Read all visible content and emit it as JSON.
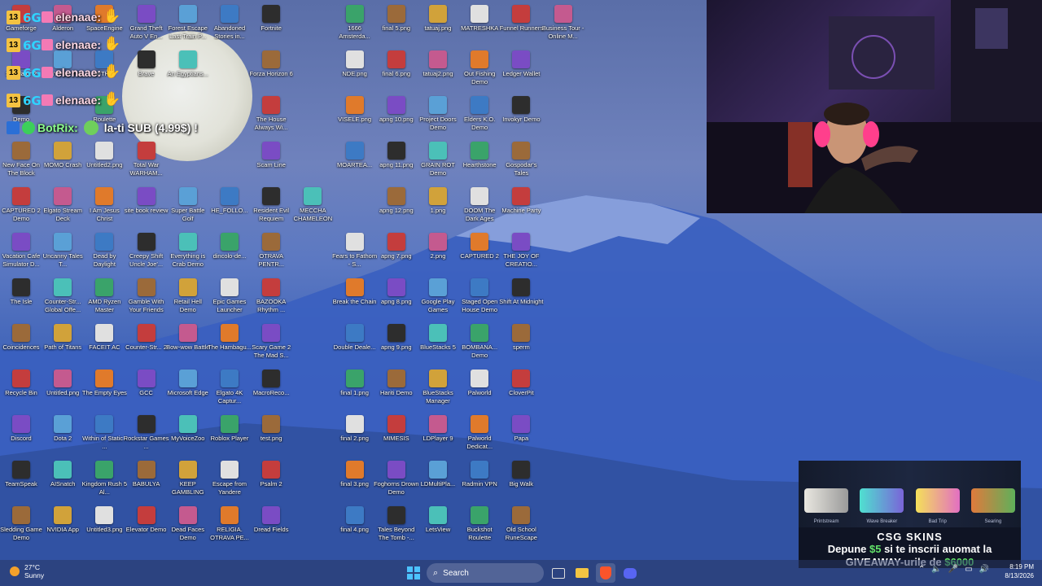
{
  "chat": {
    "messages": [
      {
        "badge": "13",
        "user": "elenaae:",
        "emote": "hands-clap"
      },
      {
        "badge": "13",
        "user": "elenaae:",
        "emote": "hands-clap"
      },
      {
        "badge": "13",
        "user": "elenaae:",
        "emote": "hands-clap"
      },
      {
        "badge": "13",
        "user": "elenaae:",
        "emote": "hands-clap"
      }
    ],
    "bot": {
      "name": "BotRix:",
      "message": "la-ti SUB (4.99$) !"
    }
  },
  "desktop": {
    "columns": [
      [
        "Gameforge",
        "Simulator ?",
        "Demo",
        "New Face On The Block",
        "CAPTURED 2 Demo",
        "Vacation Cafe Simulator D...",
        "The Isle",
        "Coincidences",
        "Recycle Bin",
        "Discord",
        "TeamSpeak",
        "Sledding Game Demo"
      ],
      [
        "Alderon",
        "Don't Play This",
        "",
        "MOMO Crash",
        "Elgato Stream Deck",
        "Uncanny Tales T...",
        "Counter-Str... Global Offe...",
        "Path of Titans",
        "Untitled.png",
        "Dota 2",
        "AISnatch",
        "NVIDIA App"
      ],
      [
        "SpaceEngine",
        "MITHAI",
        "Roulette",
        "Untitled2.png",
        "I Am Jesus Christ",
        "Dead by Daylight",
        "AMD Ryzen Master",
        "FACEIT AC",
        "The Empty Eyes",
        "Within of Static - ...",
        "Kingdom Rush 5 Al...",
        "Untitled3.png"
      ],
      [
        "Grand Theft Auto V En...",
        "Brave",
        "",
        "Total War WARHAM...",
        "site book review",
        "Creepy Shift Uncle Joe'...",
        "Gamble With Your Friends",
        "Counter-Str... 2",
        "GCC",
        "Rockstar Games ...",
        "BABULYA",
        "Elevator Demo"
      ],
      [
        "Forest Escape Last Train P...",
        "An Egyptians...",
        "",
        "",
        "Super Battle Golf",
        "Everything is Crab Demo",
        "Retail Hell Demo",
        "Bow-wow Battle",
        "Microsoft Edge",
        "MyVoiceZoo",
        "KEEP GAMBLING",
        "Dead Faces Demo"
      ],
      [
        "Abandoned Stories in...",
        "",
        "",
        "",
        "HE_FOLLO...",
        "dincolo-de...",
        "Epic Games Launcher",
        "The Hambagu...",
        "Elgato 4K Captur...",
        "Roblox Player",
        "Escape from Yandere",
        "RELIGIA. OTRAVA PE..."
      ],
      [
        "Fortnite",
        "Forza Horizon 6",
        "The House Always Wi...",
        "Scam Line",
        "Resident Evil Requiem",
        "OTRAVA PENTR...",
        "BAZOOKA Rhythm ...",
        "Scary Game 2 The Mad S...",
        "MacroReco...",
        "test.png",
        "Psalm 2",
        "Dread Fields"
      ],
      [
        "",
        "",
        "",
        "",
        "MECCHA CHAMELEON",
        "",
        "",
        "",
        "",
        "",
        "",
        ""
      ],
      [
        "1666 Amsterda...",
        "NDE.png",
        "VISELE.png",
        "MOARTEA...",
        "",
        "Fears to Fathom - S...",
        "Break the Chain",
        "Double Deale...",
        "final 1.png",
        "final 2.png",
        "final 3.png",
        "final 4.png"
      ],
      [
        "final 5.png",
        "final 6.png",
        "apng 10.png",
        "apng 11.png",
        "apng 12.png",
        "apng 7.png",
        "apng 8.png",
        "apng 9.png",
        "Hariti Demo",
        "MIMESIS",
        "Foghorns Drown Demo",
        "Tales Beyond The Tomb -..."
      ],
      [
        "tatuaj.png",
        "tatuaj2.png",
        "Project Doors Demo",
        "GRAIN ROT Demo",
        "1.png",
        "2.png",
        "Google Play Games",
        "BlueStacks 5",
        "BlueStacks Manager",
        "LDPlayer 9",
        "LDMultiPla...",
        "LetsView"
      ],
      [
        "MATRESHKA",
        "Out Fishing Demo",
        "Elders K.O. Demo",
        "Hearthstone",
        "DOOM The Dark Ages",
        "CAPTURED 2",
        "Staged Open House Demo",
        "BOMBANA... Demo",
        "Palworld",
        "Palworld Dedicat...",
        "Radmin VPN",
        "Buckshot Roulette"
      ],
      [
        "Funnel Runners",
        "Ledger Wallet",
        "Invokyr Demo",
        "Gospodar's Tales",
        "Machine Party",
        "THE JOY OF CREATIO...",
        "Shift At Midnight",
        "sperm",
        "CloverPit",
        "Papa",
        "Big Walk",
        "Old School RuneScape"
      ],
      [
        "Business Tour - Online M...",
        "",
        "",
        "",
        "",
        "",
        "",
        "",
        "",
        "",
        "",
        ""
      ]
    ]
  },
  "ad": {
    "skins": [
      "Printstream",
      "Wave Breaker",
      "Bad Trip",
      "Searing"
    ],
    "brand": "CSG SKINS",
    "line1_a": "Depune ",
    "line1_b": "$5",
    "line1_c": " si te inscrii auomat la",
    "line2_a": "GIVEAWAY-urile de ",
    "line2_b": "$6000"
  },
  "taskbar": {
    "weather_temp": "27°C",
    "weather_text": "Sunny",
    "search_placeholder": "Search",
    "time": "8:19 PM",
    "date": "8/13/2026"
  },
  "colors": {
    "accent": "#2fd3ff",
    "chat_name": "#ffd9e6",
    "bot": "#8cff8c",
    "ad_green": "#63e36a"
  }
}
